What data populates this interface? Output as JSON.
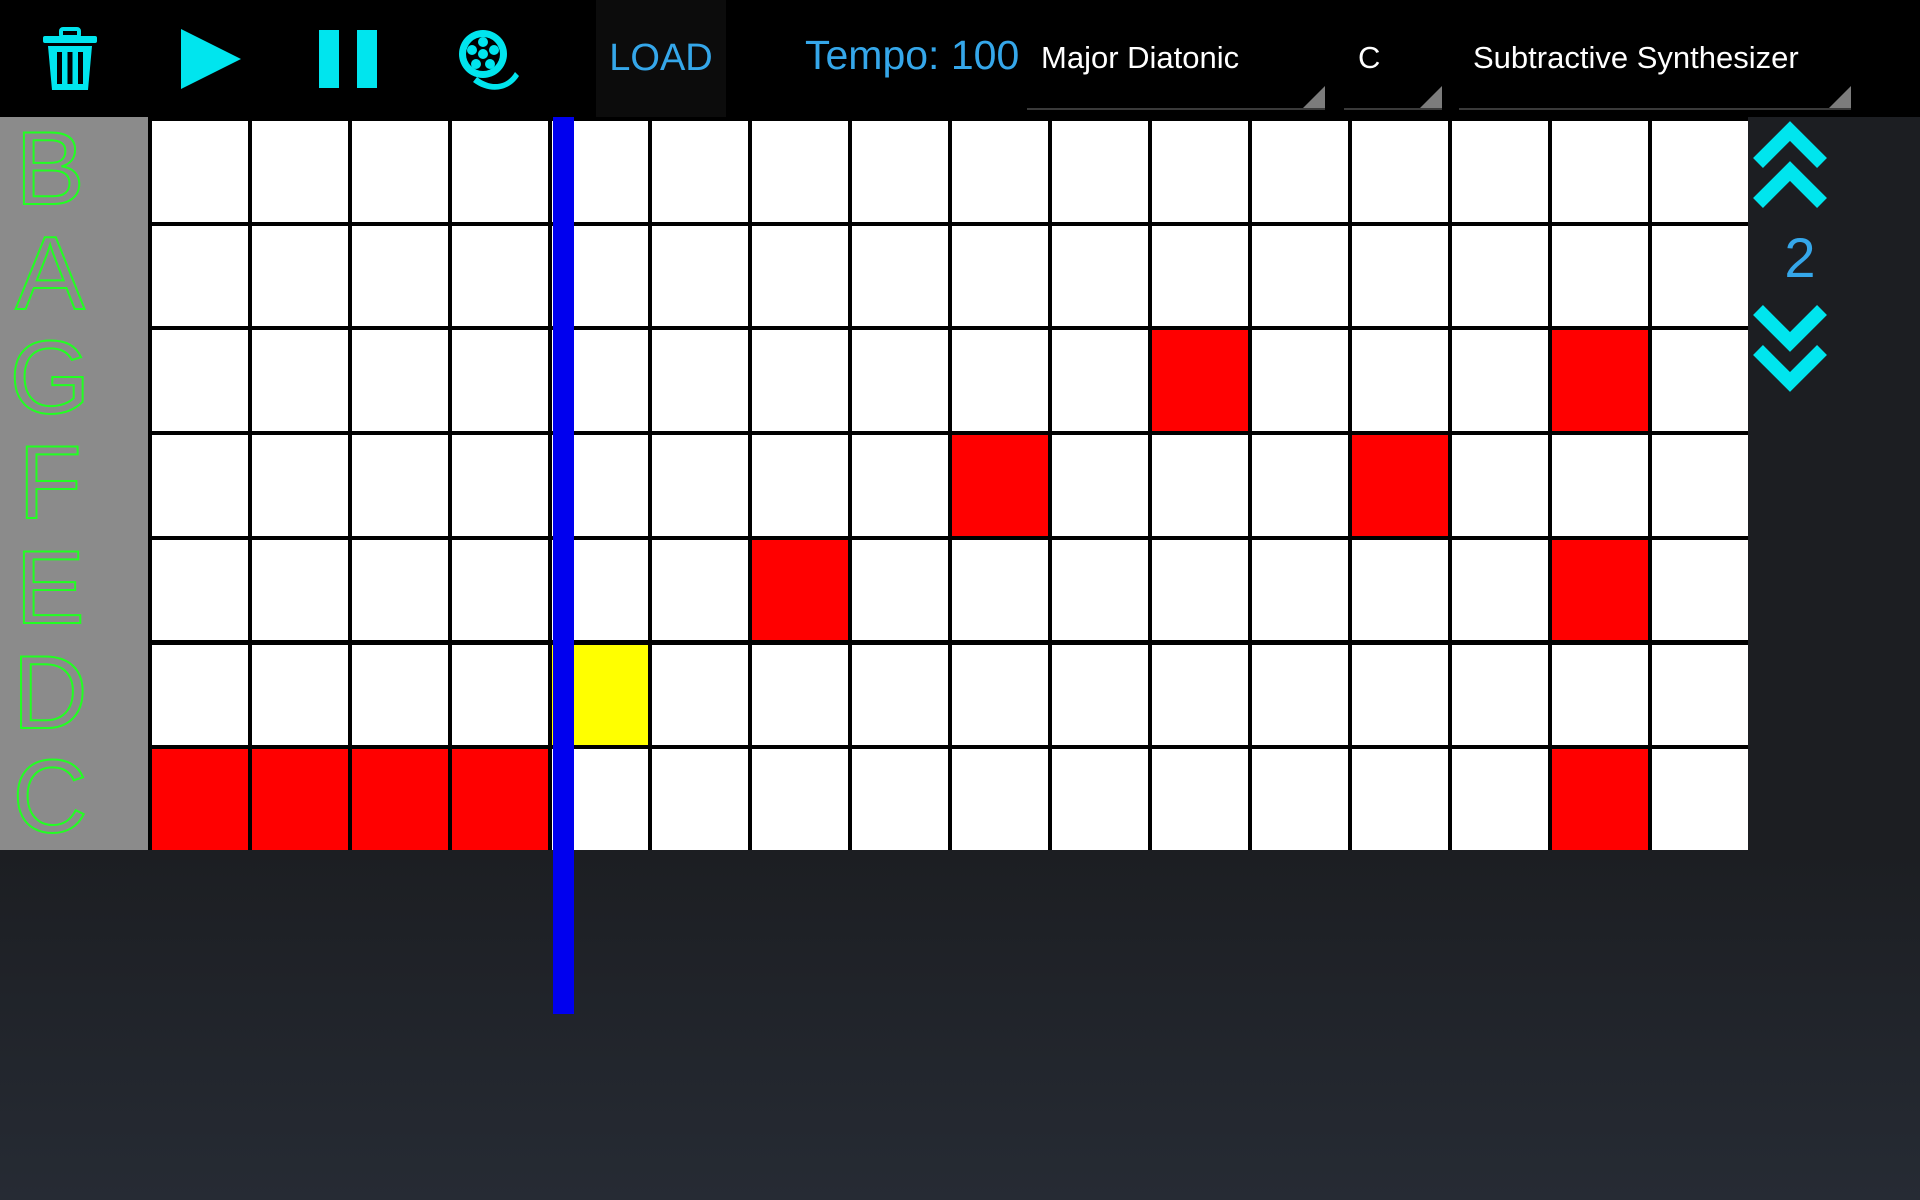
{
  "toolbar": {
    "icons": {
      "clear": "trash-icon",
      "play": "play-icon",
      "pause": "pause-icon",
      "record": "film-reel-icon"
    },
    "load_label": "LOAD",
    "tempo_label": "Tempo: 100",
    "scale_value": "Major Diatonic",
    "key_value": "C",
    "instrument_value": "Subtractive Synthesizer"
  },
  "notes": [
    "B",
    "A",
    "G",
    "F",
    "E",
    "D",
    "C"
  ],
  "grid": {
    "columns": 16,
    "active_cells": [
      {
        "note": "G",
        "step": 11
      },
      {
        "note": "G",
        "step": 15
      },
      {
        "note": "F",
        "step": 9
      },
      {
        "note": "F",
        "step": 13
      },
      {
        "note": "E",
        "step": 7
      },
      {
        "note": "E",
        "step": 15
      },
      {
        "note": "C",
        "step": 1
      },
      {
        "note": "C",
        "step": 2
      },
      {
        "note": "C",
        "step": 3
      },
      {
        "note": "C",
        "step": 4
      },
      {
        "note": "C",
        "step": 15
      }
    ],
    "current_cell": {
      "note": "D",
      "step": 5
    },
    "playhead_step": 5
  },
  "octave": {
    "value": "2",
    "up_icon": "double-chevron-up-icon",
    "down_icon": "double-chevron-down-icon"
  },
  "colors": {
    "accent": "#00e5ee",
    "text_blue": "#35a7ea",
    "note_label": "#22ff22",
    "active_cell": "#ff0000",
    "current_cell": "#ffff00",
    "playhead": "#0000ee"
  }
}
